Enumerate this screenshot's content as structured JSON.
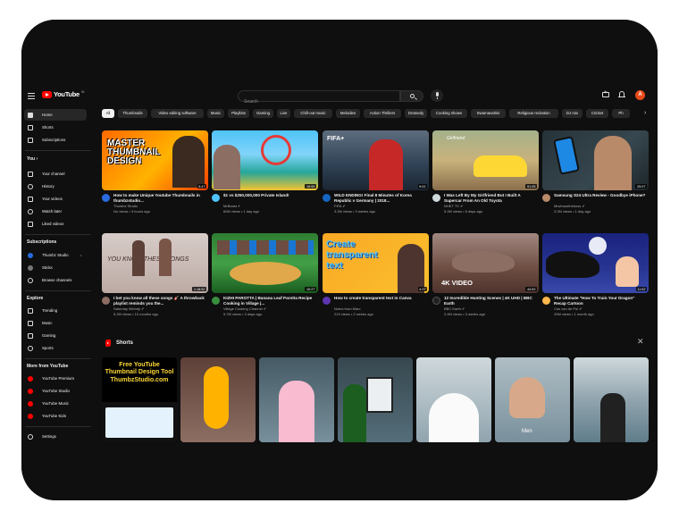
{
  "header": {
    "logo_text": "YouTube",
    "logo_sup": "IN",
    "search_placeholder": "Search",
    "avatar_letter": "A"
  },
  "sidebar": {
    "main": [
      {
        "label": "Home",
        "icon": "home-icon",
        "active": true
      },
      {
        "label": "Shorts",
        "icon": "shorts-icon"
      },
      {
        "label": "Subscriptions",
        "icon": "subscriptions-icon"
      }
    ],
    "you_title": "You",
    "you_chevron": "›",
    "you": [
      {
        "label": "Your channel",
        "icon": "channel-icon"
      },
      {
        "label": "History",
        "icon": "history-icon"
      },
      {
        "label": "Your videos",
        "icon": "your-videos-icon"
      },
      {
        "label": "Watch later",
        "icon": "watch-later-icon"
      },
      {
        "label": "Liked videos",
        "icon": "like-icon"
      }
    ],
    "subs_title": "Subscriptions",
    "subs": [
      {
        "label": "Thumbz Studio",
        "icon": "channel-avatar-icon",
        "live_dot": "•"
      },
      {
        "label": "Sticks",
        "icon": "channel-avatar-icon"
      },
      {
        "label": "Browse channels",
        "icon": "browse-channels-icon"
      }
    ],
    "explore_title": "Explore",
    "explore": [
      {
        "label": "Trending",
        "icon": "trending-icon"
      },
      {
        "label": "Music",
        "icon": "music-icon"
      },
      {
        "label": "Gaming",
        "icon": "gaming-icon"
      },
      {
        "label": "Sports",
        "icon": "sports-icon"
      }
    ],
    "more_title": "More from YouTube",
    "more": [
      {
        "label": "YouTube Premium",
        "icon": "youtube-premium-icon"
      },
      {
        "label": "YouTube Studio",
        "icon": "youtube-studio-icon"
      },
      {
        "label": "YouTube Music",
        "icon": "youtube-music-icon"
      },
      {
        "label": "YouTube Kids",
        "icon": "youtube-kids-icon"
      }
    ],
    "settings": {
      "label": "Settings",
      "icon": "settings-icon"
    }
  },
  "chips": [
    "All",
    "Thumbnails",
    "Video editing software",
    "Music",
    "Playlists",
    "Gaming",
    "Live",
    "Chill-out music",
    "Melodies",
    "Action Thrillers",
    "Dramedy",
    "Cooking shows",
    "Swarnavahini",
    "Religious recitation",
    "DJ mix",
    "Cricket",
    "Ph"
  ],
  "chip_next": "›",
  "videos": [
    {
      "title": "How to make Unique Youtube Thumbnails in thumbzstudio...",
      "channel": "Thumbz Studio",
      "meta": "No views • 3 hours ago",
      "duration": "5:47",
      "thumb_text": "MASTER THUMBNAIL DESIGN"
    },
    {
      "title": "$1 vs $250,000,000 Private Island!",
      "channel": "MrBeast ✔",
      "meta": "60M views • 1 day ago",
      "duration": "16:59",
      "thumb_text": ""
    },
    {
      "title": "WILD ENDING! Final 8 Minutes of Korea Republic v Germany | 2018...",
      "channel": "FIFA ✔",
      "meta": "3.2M views • 3 weeks ago",
      "duration": "9:02",
      "thumb_text": "FIFA+"
    },
    {
      "title": "I Was Left By My Girlfriend But I Built A Supercar From An Old Toyota",
      "channel": "NHẸT TV ✔",
      "meta": "5.2M views • 6 days ago",
      "duration": "51:05",
      "thumb_text": "Girlfriend"
    },
    {
      "title": "Samsung S24 Ultra Review - Goodbye iPhone?",
      "channel": "Mrwhosetheboss ✔",
      "meta": "3.2M views • 1 day ago",
      "duration": "25:07",
      "thumb_text": ""
    },
    {
      "title": "I bet you know all these songs 🎸 A throwback playlist reminds you the...",
      "channel": "Saturday Melody ✔",
      "meta": "5.2M views • 10 months ago",
      "duration": "1:18:52",
      "thumb_text": "YOU KNOW THESE SONGS"
    },
    {
      "title": "KIZHI PAROTTA | Banana Leaf Parotta Recipe Cooking in Village |...",
      "channel": "Village Cooking Channel ✔",
      "meta": "5.7M views • 3 days ago",
      "duration": "10:27",
      "thumb_text": ""
    },
    {
      "title": "How to create transparent text in Canva",
      "channel": "Notes from Marc",
      "meta": "219 views • 2 weeks ago",
      "duration": "4:37",
      "thumb_text": "Create transparent text"
    },
    {
      "title": "12 Incredible Hunting Scenes | 4K UHD | BBC Earth",
      "channel": "BBC Earth ✔",
      "meta": "2.4M views • 3 weeks ago",
      "duration": "44:52",
      "thumb_text": "4K VIDEO"
    },
    {
      "title": "The Ultimate \"How To Train Your Dragon\" Recap Cartoon",
      "channel": "Cas van de Pol ✔",
      "meta": "20M views • 1 month ago",
      "duration": "11:52",
      "thumb_text": ""
    }
  ],
  "shorts": {
    "title": "Shorts",
    "close": "✕",
    "first_text": "Free YouTube Thumbnail Design Tool ThumbzStudio.com",
    "men_caption": "Men"
  },
  "colors": {
    "accent": "#ff0000",
    "background": "#0f0f0f",
    "chip": "#272727"
  }
}
